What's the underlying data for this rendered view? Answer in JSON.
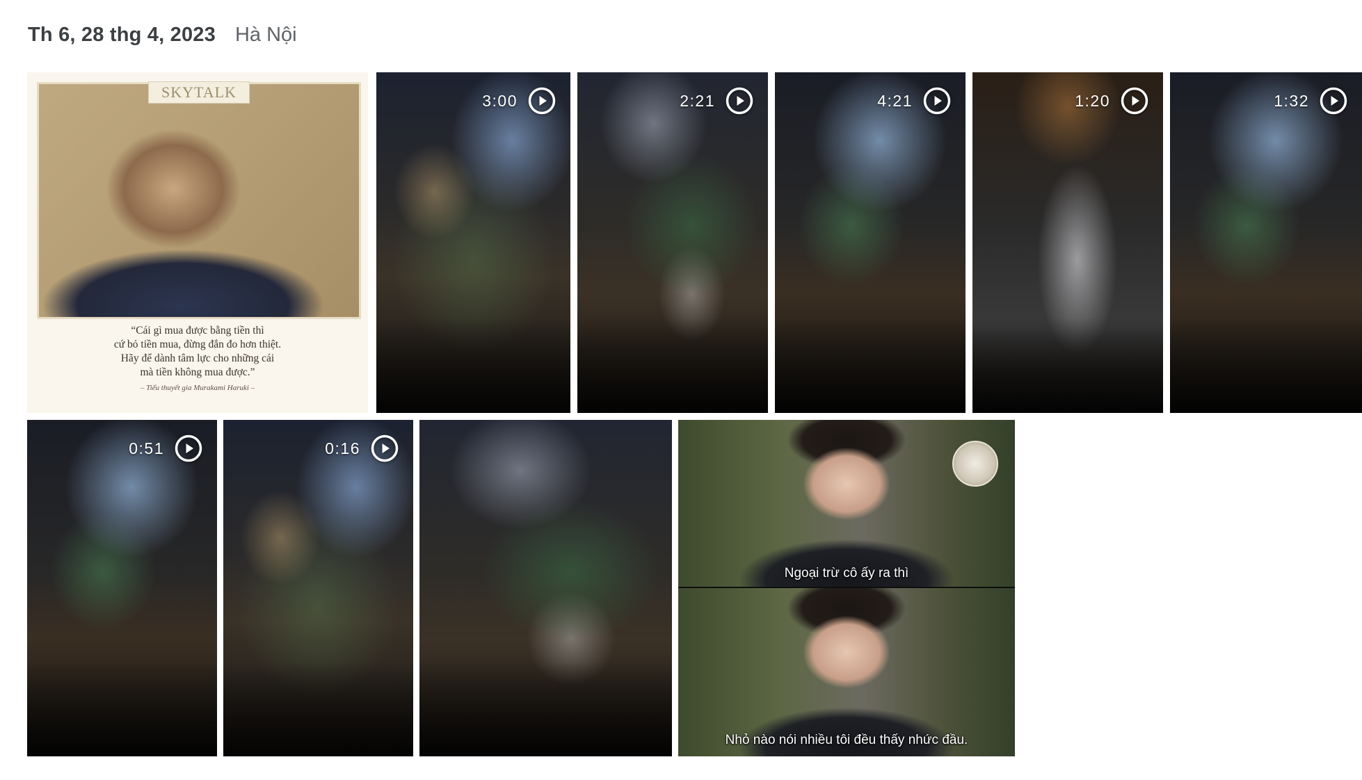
{
  "header": {
    "date": "Th 6, 28 thg 4, 2023",
    "location": "Hà Nội"
  },
  "icons": {
    "play": "play-circle-icon"
  },
  "tiles": {
    "quote": {
      "brand": "SKYTALK",
      "quote_lines": [
        "“Cái gì mua được bằng tiền thì",
        "cứ bỏ tiền mua, đừng đắn đo hơn thiệt.",
        "Hãy để dành tâm lực cho những cái",
        "mà tiền không mua được.”"
      ],
      "attribution": "– Tiểu thuyết gia Murakami Haruki –"
    },
    "videos": [
      {
        "duration": "3:00"
      },
      {
        "duration": "2:21"
      },
      {
        "duration": "4:21"
      },
      {
        "duration": "1:20"
      },
      {
        "duration": "1:32"
      },
      {
        "duration": "0:51"
      },
      {
        "duration": "0:16"
      }
    ],
    "drama": {
      "subtitle_top": "Ngoại trừ cô ấy ra thì",
      "subtitle_bottom": "Nhỏ nào nói nhiều tôi đều thấy nhức đầu."
    }
  }
}
